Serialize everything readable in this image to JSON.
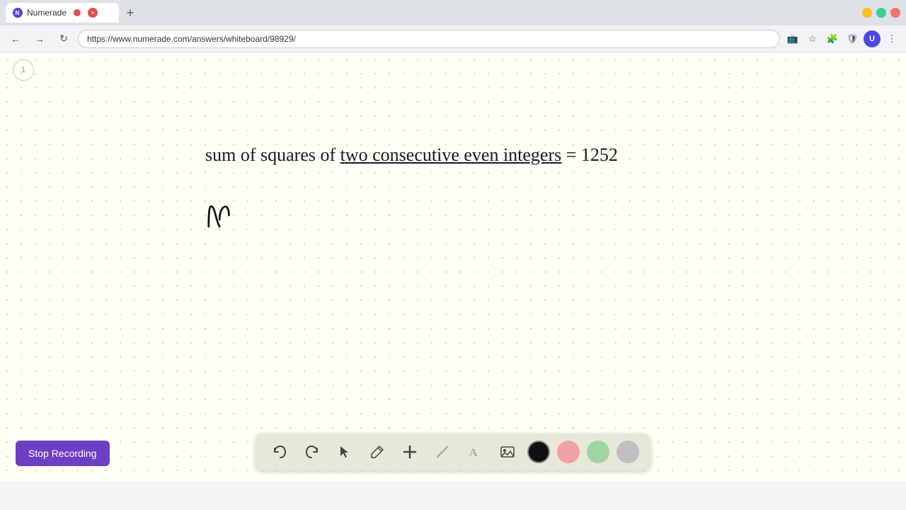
{
  "browser": {
    "tab_label": "Numerade",
    "tab_close_label": "×",
    "tab_new_label": "+",
    "url": "https://www.numerade.com/answers/whiteboard/98929/",
    "window_minimize": "—",
    "window_maximize": "□",
    "window_close": "×"
  },
  "slide": {
    "number": "1"
  },
  "content": {
    "main_text_prefix": "sum of squares of ",
    "main_text_underlined": "two consecutive even integers",
    "main_text_suffix": " = 1252",
    "handwritten": "η"
  },
  "toolbar": {
    "undo_label": "↺",
    "redo_label": "↻",
    "select_label": "▲",
    "pen_label": "✏",
    "plus_label": "+",
    "eraser_label": "/",
    "text_label": "A",
    "image_label": "🖼",
    "colors": [
      "#111111",
      "#f4a0a8",
      "#a0d4a0",
      "#c0c0c0"
    ]
  },
  "stop_recording": {
    "label": "Stop Recording"
  }
}
